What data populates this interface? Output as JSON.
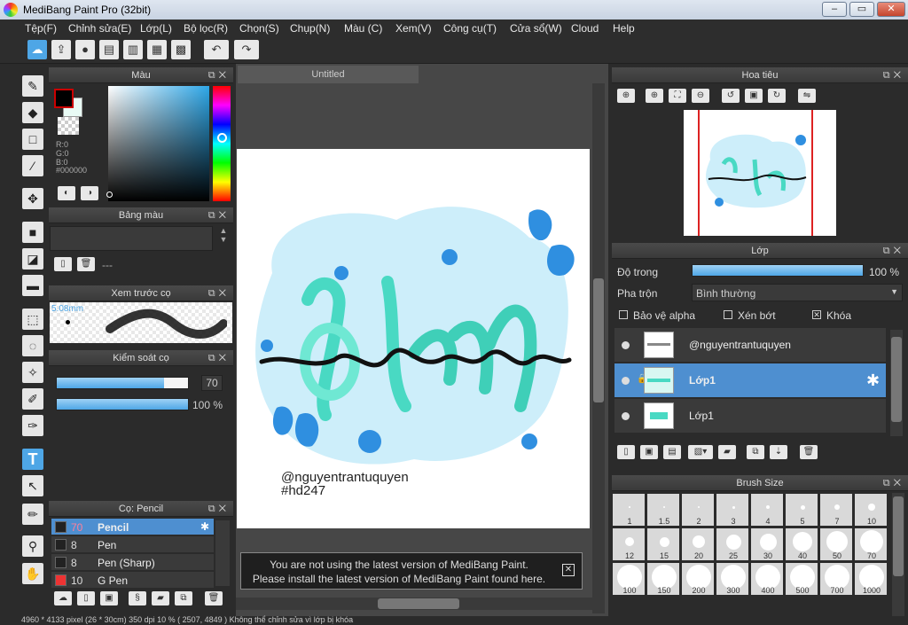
{
  "window": {
    "title": "MediBang Paint Pro (32bit)",
    "min": "–",
    "max": "▭",
    "close": "✕"
  },
  "menu": [
    "Tệp(F)",
    "Chỉnh sửa(E)",
    "Lớp(L)",
    "Bộ lọc(R)",
    "Chọn(S)",
    "Chụp(N)",
    "Màu (C)",
    "Xem(V)",
    "Công cụ(T)",
    "Cửa sổ(W)",
    "Cloud",
    "Help"
  ],
  "toolbar_icons": [
    "cloud-icon",
    "upload-icon",
    "comment-icon",
    "chat-icon",
    "page-icon",
    "grid-icon",
    "tiles-icon",
    "undo-icon",
    "redo-icon"
  ],
  "tools": [
    "brush-icon",
    "eraser-icon",
    "rectangle-icon",
    "dot-brush-icon",
    "move-icon",
    "fill-rect-icon",
    "bucket-icon",
    "gradient-icon",
    "select-rect-icon",
    "lasso-icon",
    "magic-wand-icon",
    "select-pen-icon",
    "select-eraser-icon",
    "text-icon",
    "operation-icon",
    "eyedropper-pen-icon",
    "dropper-icon",
    "hand-icon"
  ],
  "panels": {
    "color": {
      "title": "Màu",
      "r": "R:0",
      "g": "G:0",
      "b": "B:0",
      "hex": "#000000",
      "fg": "#000000",
      "bg": "#e9fbf5"
    },
    "palette": {
      "title": "Bảng màu",
      "empty": "---"
    },
    "brush_preview": {
      "title": "Xem trước cọ",
      "size": "5.08mm"
    },
    "brush_control": {
      "title": "Kiểm soát cọ",
      "size_value": "70",
      "opacity_value": "100 %",
      "size_fraction": 0.82,
      "opacity_fraction": 1.0
    },
    "brush_list": {
      "title": "Cọ: Pencil",
      "items": [
        {
          "size": "70",
          "name": "Pencil",
          "color": "#222222",
          "selected": true
        },
        {
          "size": "8",
          "name": "Pen",
          "color": "#222222",
          "selected": false
        },
        {
          "size": "8",
          "name": "Pen (Sharp)",
          "color": "#222222",
          "selected": false
        },
        {
          "size": "10",
          "name": "G Pen",
          "color": "#ee3333",
          "selected": false
        }
      ]
    },
    "navigator": {
      "title": "Hoa tiêu"
    },
    "layers": {
      "title": "Lớp",
      "opacity_label": "Độ trong",
      "opacity_value": "100 %",
      "opacity_fraction": 1.0,
      "blend_label": "Pha trộn",
      "blend_value": "Bình thường",
      "check_alpha": "Bảo vệ alpha",
      "check_clip": "Xén bớt",
      "check_lock": "Khóa",
      "items": [
        {
          "name": "@nguyentrantuquyen",
          "selected": false
        },
        {
          "name": "Lớp1",
          "selected": true
        },
        {
          "name": "Lớp1",
          "selected": false
        }
      ]
    },
    "brush_size": {
      "title": "Brush Size",
      "sizes": [
        "1",
        "1.5",
        "2",
        "3",
        "4",
        "5",
        "7",
        "10",
        "12",
        "15",
        "20",
        "25",
        "30",
        "40",
        "50",
        "70",
        "100",
        "150",
        "200",
        "300",
        "400",
        "500",
        "700",
        "1000"
      ]
    }
  },
  "canvas": {
    "tab": "Untitled",
    "credit_line1": "@nguyentrantuquyen",
    "credit_line2": "#hd247"
  },
  "notice": {
    "line1": "You are not using the latest version of MediBang Paint.",
    "line2": "Please install the latest version of MediBang Paint found here.",
    "close": "✕"
  },
  "status": "4960 * 4133 pixel   (26 * 30cm)   350 dpi   10 %   ( 2507, 4849 )   Không thể chỉnh sửa vì lớp bị khóa"
}
